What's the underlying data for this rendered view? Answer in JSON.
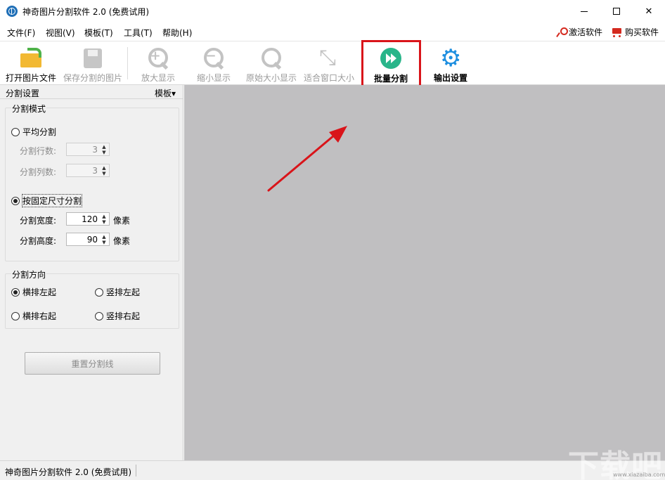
{
  "window": {
    "title": "神奇图片分割软件 2.0 (免费试用)",
    "controls": {
      "minimize": "—",
      "maximize": "☐",
      "close": "✕"
    }
  },
  "menu": {
    "items": [
      "文件(F)",
      "视图(V)",
      "模板(T)",
      "工具(T)",
      "帮助(H)"
    ],
    "activate": "激活软件",
    "buy": "购买软件"
  },
  "toolbar": {
    "open": "打开图片文件",
    "save": "保存分割的图片",
    "zoom_in": "放大显示",
    "zoom_out": "缩小显示",
    "original": "原始大小显示",
    "fit": "适合窗口大小",
    "batch": "批量分割",
    "output": "输出设置"
  },
  "panel": {
    "title": "分割设置",
    "template": "模板▾",
    "mode_group": "分割模式",
    "mode_even": "平均分割",
    "rows_label": "分割行数:",
    "rows_value": "3",
    "cols_label": "分割列数:",
    "cols_value": "3",
    "mode_fixed": "按固定尺寸分割",
    "width_label": "分割宽度:",
    "width_value": "120",
    "height_label": "分割高度:",
    "height_value": "90",
    "unit": "像素",
    "direction_group": "分割方向",
    "dir_h_left": "横排左起",
    "dir_v_left": "竖排左起",
    "dir_h_right": "横排右起",
    "dir_v_right": "竖排右起",
    "reset": "重置分割线"
  },
  "status": {
    "text": "神奇图片分割软件 2.0 (免费试用)"
  },
  "watermark": {
    "text": "下载吧",
    "sub": "www.xiazaiba.com"
  },
  "colors": {
    "accent_red": "#d9141a",
    "batch_green": "#29b58a",
    "gear_blue": "#1e8fe0",
    "canvas": "#c0bfc1"
  }
}
